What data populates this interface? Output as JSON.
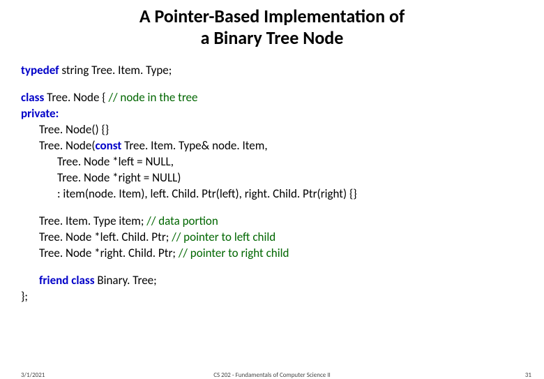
{
  "title_line1": "A Pointer-Based Implementation of",
  "title_line2": "a Binary Tree Node",
  "typedef_kw": "typedef",
  "typedef_rest": " string Tree. Item. Type;",
  "class_kw": "class",
  "class_name": " Tree. Node {           ",
  "class_cm": "// node in the tree",
  "private_kw": "private:",
  "ctor1": "Tree. Node() {}",
  "ctor2a": "Tree. Node(",
  "const_kw": "const",
  "ctor2b": " Tree. Item. Type& node. Item,",
  "ctor3": "Tree. Node *left = NULL,",
  "ctor4": "Tree. Node *right = NULL)",
  "ctor5": ": item(node. Item), left. Child. Ptr(left), right. Child. Ptr(right) {}",
  "mem1a": "Tree. Item. Type item;       ",
  "mem1cm": "// data portion",
  "mem2a": "Tree. Node *left. Child. Ptr;   ",
  "mem2cm": "// pointer to left child",
  "mem3a": "Tree. Node *right. Child. Ptr; ",
  "mem3cm": "// pointer to right child",
  "friend_kw": "friend class",
  "friend_name": " Binary. Tree;",
  "close": "};",
  "footer_left": "3/1/2021",
  "footer_center": "CS 202 - Fundamentals of Computer Science II",
  "footer_right": "31"
}
